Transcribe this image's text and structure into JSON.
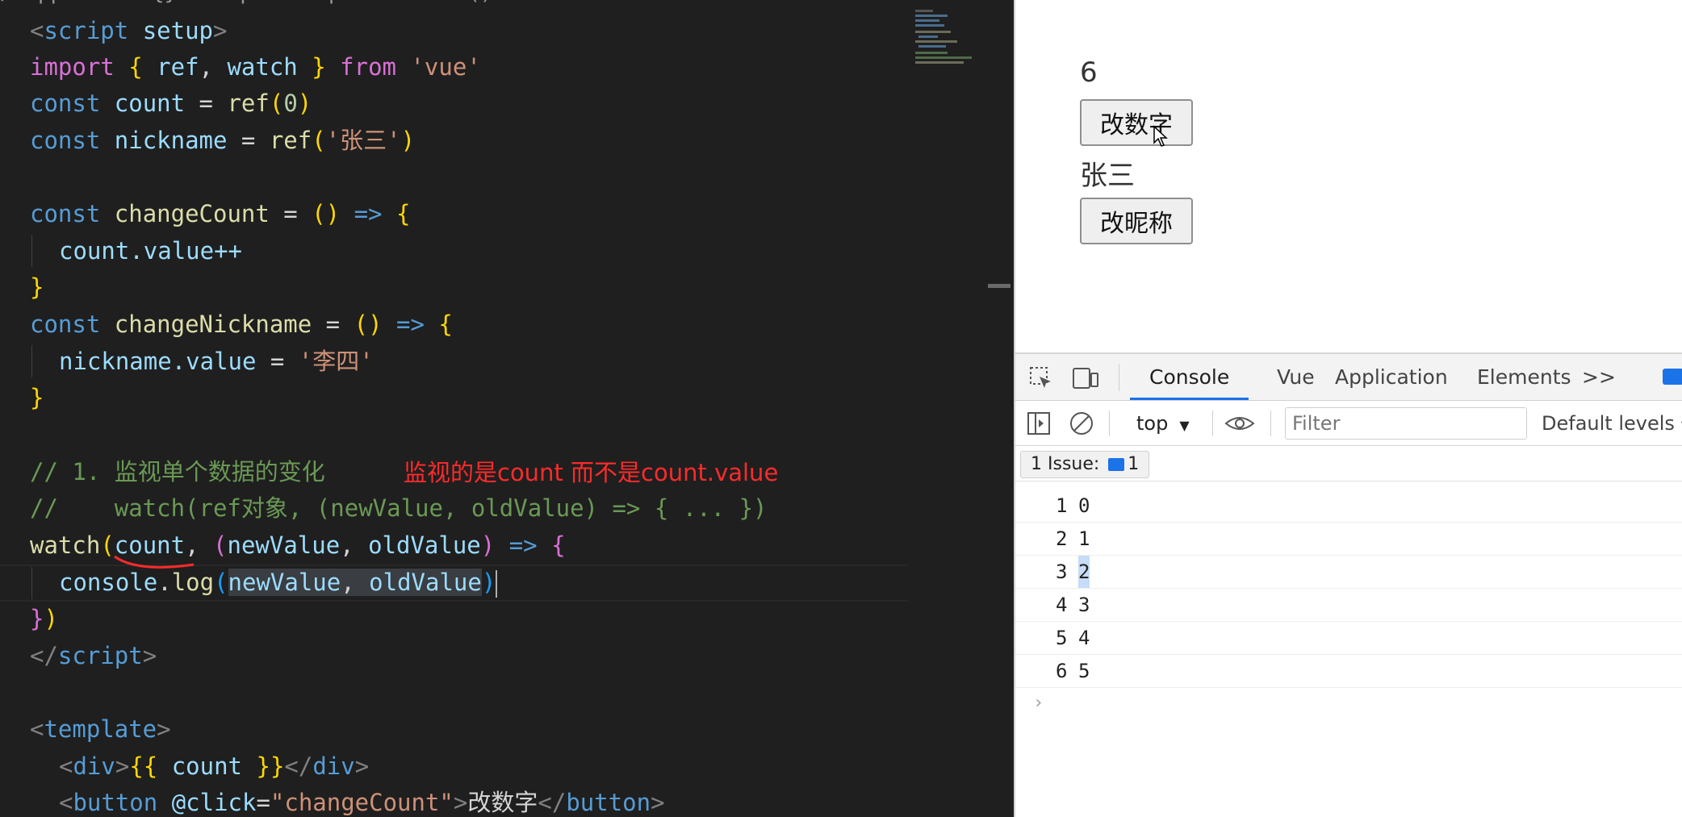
{
  "editor": {
    "top_cut_text": "/ App.vue > {} script setup > ⊙ watch() callback",
    "lines": {
      "l1": {
        "a": "<",
        "b": "script",
        "c": " setup",
        "d": ">"
      },
      "l2": {
        "kw": "import",
        "b1": " { ",
        "v1": "ref",
        "c1": ", ",
        "v2": "watch",
        "b2": " } ",
        "kw2": "from",
        "s": " 'vue'"
      },
      "l3": {
        "kw": "const",
        "v": " count",
        "op": " = ",
        "fn": "ref",
        "p1": "(",
        "n": "0",
        "p2": ")"
      },
      "l4": {
        "kw": "const",
        "v": " nickname",
        "op": " = ",
        "fn": "ref",
        "p1": "(",
        "s": "'张三'",
        "p2": ")"
      },
      "l6": {
        "kw": "const",
        "fn": " changeCount",
        "op": " = ",
        "p": "()",
        "ar": " => ",
        "b": "{"
      },
      "l7": {
        "v": "count",
        "d": ".value++"
      },
      "l8": {
        "b": "}"
      },
      "l9": {
        "kw": "const",
        "fn": " changeNickname",
        "op": " = ",
        "p": "()",
        "ar": " => ",
        "b": "{"
      },
      "l10": {
        "v": "nickname",
        "d": ".value",
        "op": " = ",
        "s": "'李四'"
      },
      "l11": {
        "b": "}"
      },
      "l13": {
        "c": "// 1. 监视单个数据的变化"
      },
      "l14": {
        "c": "//    watch(ref对象, (newValue, oldValue) => { ... })"
      },
      "l15": {
        "fn": "watch",
        "p1": "(",
        "v1": "count",
        "c1": ", ",
        "p2": "(",
        "v2": "newValue",
        "c2": ", ",
        "v3": "oldValue",
        "p3": ")",
        "ar": " => ",
        "b": "{"
      },
      "l16": {
        "v1": "console",
        "d": ".",
        "fn": "log",
        "p1": "(",
        "v2": "newValue",
        "c": ", ",
        "v3": "oldValue",
        "p2": ")"
      },
      "l17": {
        "b": "}",
        "p": ")"
      },
      "l18": {
        "a": "</",
        "b": "script",
        "d": ">"
      },
      "l20": {
        "a": "<",
        "b": "template",
        "d": ">"
      },
      "l21": {
        "a": "<",
        "b": "div",
        "d": ">",
        "m1": "{{ ",
        "v": "count",
        "m2": " }}",
        "e1": "</",
        "e2": "div",
        "e3": ">"
      },
      "l22": {
        "a": "<",
        "b": "button",
        "at": " @click",
        "eq": "=",
        "s": "\"changeCount\"",
        "d": ">",
        "t": "改数字",
        "e1": "</",
        "e2": "button",
        "e3": ">"
      }
    },
    "annotation": "监视的是count 而不是count.value"
  },
  "browser": {
    "count_value": "6",
    "change_count_button": "改数字",
    "nickname_value": "张三",
    "change_nickname_button": "改昵称"
  },
  "devtools": {
    "tabs": [
      "Console",
      "Vue",
      "Application",
      "Elements"
    ],
    "more_tabs": ">>",
    "context": "top",
    "filter_placeholder": "Filter",
    "levels": "Default levels",
    "issues_label": "1 Issue:",
    "issues_count": "1",
    "logs": [
      {
        "a": "1",
        "b": "0"
      },
      {
        "a": "2",
        "b": "1"
      },
      {
        "a": "3",
        "b": "2"
      },
      {
        "a": "4",
        "b": "3"
      },
      {
        "a": "5",
        "b": "4"
      },
      {
        "a": "6",
        "b": "5"
      }
    ],
    "prompt": "›"
  },
  "colors": {
    "accent": "#1a73e8",
    "annotation": "#ff2a2a"
  }
}
